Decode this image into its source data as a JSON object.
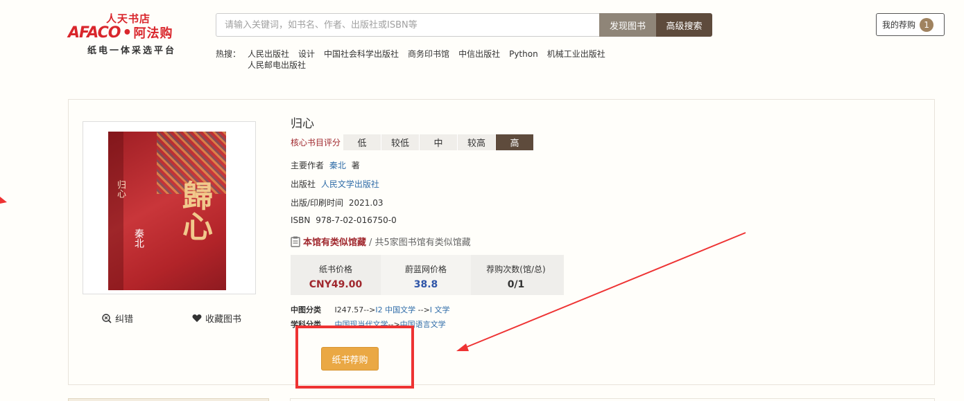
{
  "header": {
    "logo": {
      "store": "人天书店",
      "mark": "AFACO",
      "cn": "阿法购",
      "slogan": "纸电一体采选平台"
    },
    "search": {
      "placeholder": "请输入关键词，如书名、作者、出版社或ISBN等",
      "discover_label": "发现图书",
      "advanced_label": "高级搜索"
    },
    "hot": {
      "label": "热搜：",
      "items": [
        "人民出版社",
        "设计",
        "中国社会科学出版社",
        "商务印书馆",
        "中信出版社",
        "Python",
        "机械工业出版社",
        "人民邮电出版社"
      ]
    },
    "my_recommend": {
      "label": "我的荐购",
      "count": "1"
    }
  },
  "book": {
    "title": "归心",
    "cover": {
      "title_big": "歸心",
      "side_title": "归心",
      "author": "秦北"
    },
    "rating": {
      "label": "核心书目评分",
      "levels": [
        "低",
        "较低",
        "中",
        "较高",
        "高"
      ],
      "active": "高"
    },
    "author": {
      "label": "主要作者",
      "name": "秦北",
      "suffix": "著"
    },
    "publisher": {
      "label": "出版社",
      "name": "人民文学出版社"
    },
    "pubdate": {
      "label": "出版/印刷时间",
      "value": "2021.03"
    },
    "isbn": {
      "label": "ISBN",
      "value": "978-7-02-016750-0"
    },
    "holdings": {
      "highlight": "本馆有类似馆藏",
      "rest": "/ 共5家图书馆有类似馆藏"
    },
    "prices": [
      {
        "key": "纸书价格",
        "value": "CNY49.00"
      },
      {
        "key": "蔚蓝网价格",
        "value": "38.8"
      },
      {
        "key": "荐购次数(馆/总)",
        "value": "0/1"
      }
    ],
    "classification": {
      "clc": {
        "label": "中图分类",
        "prefix": "I247.57-->",
        "l1": "I2 中国文学",
        "sep": " -->",
        "l2": "I 文学"
      },
      "subject": {
        "label": "学科分类",
        "l1": "中国现当代文学",
        "sep": "-->",
        "l2": "中国语言文学"
      }
    },
    "actions": {
      "fix": "纠错",
      "favorite": "收藏图书",
      "recommend": "纸书荐购"
    }
  },
  "colors": {
    "accent_brown": "#5e4b3c",
    "price_red": "#a0282e",
    "link_blue": "#2f6ca8",
    "button_orange": "#eaa844",
    "annotation_red": "#ee3333"
  }
}
